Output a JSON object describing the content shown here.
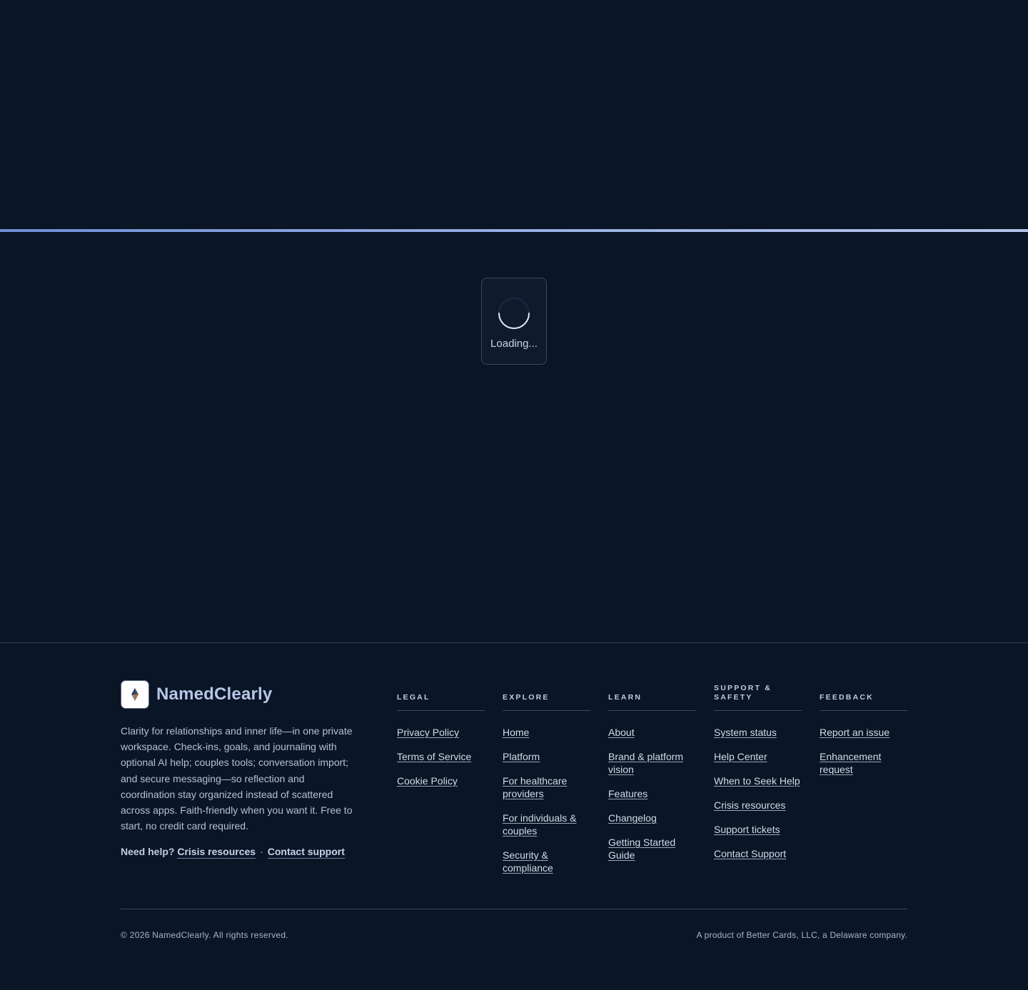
{
  "loading": {
    "text": "Loading...",
    "progress_percent": 100
  },
  "brand": {
    "name": "NamedClearly",
    "logo_icon": "diamond-compass-icon",
    "description": "Clarity for relationships and inner life—in one private workspace. Check-ins, goals, and journaling with optional AI help; couples tools; conversation import; and secure messaging—so reflection and coordination stay organized instead of scattered across apps. Faith-friendly when you want it. Free to start, no credit card required."
  },
  "help": {
    "label": "Need help?",
    "crisis_link": "Crisis resources",
    "separator": "·",
    "contact_link": "Contact support"
  },
  "columns": {
    "legal": {
      "title": "LEGAL",
      "links": [
        "Privacy Policy",
        "Terms of Service",
        "Cookie Policy"
      ]
    },
    "explore": {
      "title": "EXPLORE",
      "links": [
        "Home",
        "Platform",
        "For healthcare providers",
        "For individuals & couples",
        "Security & compliance"
      ]
    },
    "learn": {
      "title": "LEARN",
      "links": [
        "About",
        "Brand & platform vision",
        "Features",
        "Changelog",
        "Getting Started Guide"
      ]
    },
    "support": {
      "title": "SUPPORT & SAFETY",
      "links": [
        "System status",
        "Help Center",
        "When to Seek Help",
        "Crisis resources",
        "Support tickets",
        "Contact Support"
      ]
    },
    "feedback": {
      "title": "FEEDBACK",
      "links": [
        "Report an issue",
        "Enhancement request"
      ]
    }
  },
  "footer": {
    "copyright": "© 2026 NamedClearly. All rights reserved.",
    "product": "A product of Better Cards, LLC, a Delaware company."
  },
  "colors": {
    "background": "#0a1525",
    "accent": "#9fb4e6",
    "text": "#c9d3e1"
  }
}
